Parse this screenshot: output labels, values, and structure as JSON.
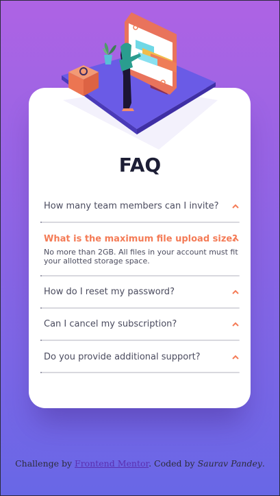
{
  "page": {
    "title": "FAQ",
    "colors": {
      "bg_top": "#ae63e4",
      "bg_bottom": "#6867e6",
      "accent": "#f47b56",
      "text": "#4a4b5e",
      "heading": "#1d1e35"
    }
  },
  "faq": {
    "items": [
      {
        "question": "How many team members can I invite?",
        "answer": "",
        "open": false
      },
      {
        "question": "What is the maximum file upload size?",
        "answer": "No more than 2GB. All files in your account must fit your allotted storage space.",
        "open": true
      },
      {
        "question": "How do I reset my password?",
        "answer": "",
        "open": false
      },
      {
        "question": "Can I cancel my subscription?",
        "answer": "",
        "open": false
      },
      {
        "question": "Do you provide additional support?",
        "answer": "",
        "open": false
      }
    ]
  },
  "footer": {
    "prefix": "Challenge by ",
    "link_label": "Frontend Mentor",
    "middle": ". Coded by ",
    "coder": "Saurav Pandey",
    "suffix": "."
  },
  "icons": {
    "hero": "woman-online-illustration",
    "chevron": "chevron-up-icon"
  }
}
